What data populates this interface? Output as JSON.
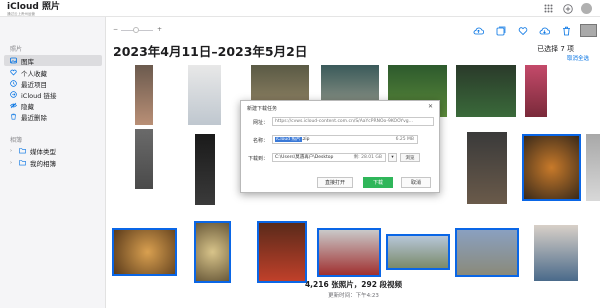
{
  "app": {
    "title": "iCloud 照片",
    "subtitle": "通过云上贵州运营"
  },
  "sidebar": {
    "photos_header": "照片",
    "items": [
      {
        "label": "图库",
        "icon": "photo-library-icon"
      },
      {
        "label": "个人收藏",
        "icon": "heart-icon"
      },
      {
        "label": "最近项目",
        "icon": "clock-icon"
      },
      {
        "label": "iCloud 链接",
        "icon": "link-icon"
      },
      {
        "label": "隐藏",
        "icon": "eye-slash-icon"
      },
      {
        "label": "最近删除",
        "icon": "trash-icon"
      }
    ],
    "albums_header": "相簿",
    "album_groups": [
      {
        "label": "媒体类型",
        "icon": "folder-icon"
      },
      {
        "label": "我的相簿",
        "icon": "folder-icon"
      }
    ]
  },
  "main": {
    "date_range": "2023年4月11日–2023年5月2日",
    "selected_count": "已选择 7 项",
    "deselect_all": "取消全选",
    "summary": "4,216 张照片，292 段视频",
    "updated": "更新时间：下午4:23"
  },
  "dialog": {
    "title": "新建下载任务",
    "url_label": "网址：",
    "url_value": "https://cvws.icloud-content.com.cn/S/AaYcPRNOo-9KOOYvg...",
    "name_label": "名称：",
    "name_selected": "iCloud 照片",
    "name_ext": ".zip",
    "name_size": "6.25 MB",
    "dir_label": "下载到：",
    "dir_value": "C:\\Users\\莫遇再户\\Desktop",
    "dir_free": "剩: 28.01 GB",
    "browse": "浏览",
    "open_btn": "直接打开",
    "download_btn": "下载",
    "cancel_btn": "取消"
  },
  "colors": {
    "accent": "#0071e3",
    "selection": "#0a66e6",
    "download_green": "#2fb65a"
  }
}
